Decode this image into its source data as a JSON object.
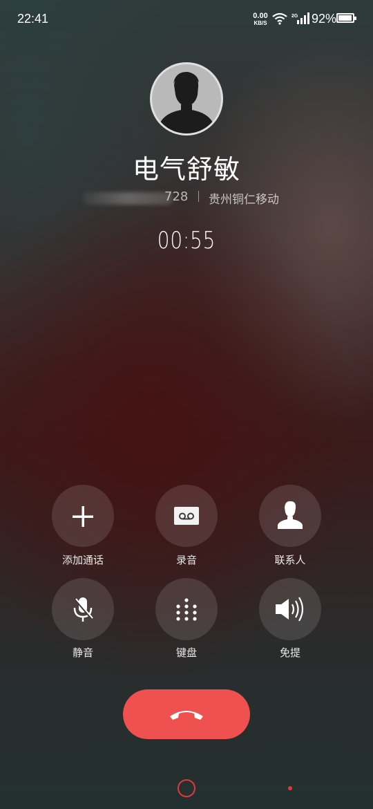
{
  "status_bar": {
    "time": "22:41",
    "net_speed_value": "0.00",
    "net_speed_unit": "KB/S",
    "signal_label": "2G",
    "battery_percent": "92%",
    "battery_level": 0.92
  },
  "caller": {
    "name": "电气舒敏",
    "number_visible": "728",
    "location": "贵州铜仁移动",
    "duration": "00:55"
  },
  "controls": [
    {
      "label": "添加通话",
      "icon": "add-call-icon"
    },
    {
      "label": "录音",
      "icon": "record-icon"
    },
    {
      "label": "联系人",
      "icon": "contacts-icon"
    },
    {
      "label": "静音",
      "icon": "mute-icon"
    },
    {
      "label": "键盘",
      "icon": "keypad-icon"
    },
    {
      "label": "免提",
      "icon": "speaker-icon"
    }
  ],
  "end_call": {
    "icon": "hang-up-icon",
    "color": "#ef5050"
  },
  "nav": {
    "accent": "#e0393c"
  }
}
